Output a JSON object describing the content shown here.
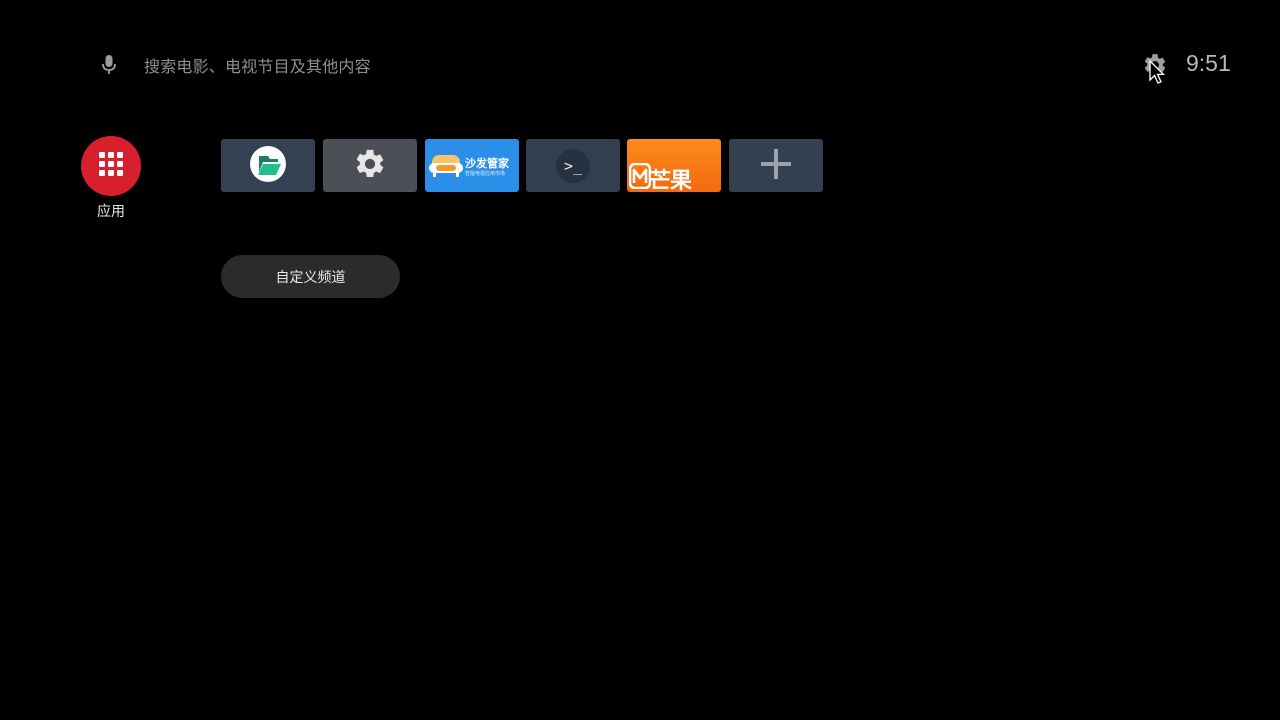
{
  "search": {
    "placeholder": "搜索电影、电视节目及其他内容"
  },
  "status": {
    "time": "9:51"
  },
  "apps": {
    "label": "应用"
  },
  "favorites": [
    {
      "name": "文件管理",
      "icon": "files-app-icon"
    },
    {
      "name": "设置",
      "icon": "settings-gear-icon"
    },
    {
      "name": "沙发管家",
      "icon": "sofa-icon",
      "title": "沙发管家",
      "subtitle": "智能电视应用市场"
    },
    {
      "name": "终端",
      "icon": "terminal-icon",
      "glyph": ">_"
    },
    {
      "name": "芒果TV",
      "icon": "mango-tv-icon",
      "text": "芒果"
    },
    {
      "name": "添加",
      "icon": "plus-icon"
    }
  ],
  "channel_button": {
    "label": "自定义频道"
  },
  "colors": {
    "background": "#000000",
    "apps_red": "#d71f2e"
  }
}
